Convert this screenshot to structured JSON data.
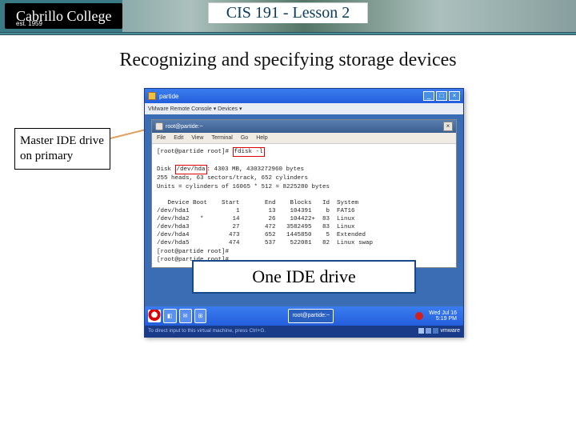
{
  "header": {
    "logo_text": "Cabrillo College",
    "logo_est": "est. 1959",
    "title": "CIS 191 - Lesson 2"
  },
  "slide": {
    "title": "Recognizing and specifying storage devices",
    "annotation": "Master  IDE drive on primary",
    "overlay": "One IDE drive"
  },
  "vm": {
    "title": "partide",
    "console_label": "VMware Remote Console ▾  Devices ▾",
    "win_min": "_",
    "win_max": "□",
    "win_close": "×",
    "status_left": "To direct input to this virtual machine, press Ctrl+G.",
    "brand": "vmware",
    "taskbar": {
      "term_label": "root@partide:~",
      "clock_day": "Wed Jul 16",
      "clock_time": "5:19 PM"
    }
  },
  "terminal": {
    "title": "root@partide:~",
    "menu": {
      "file": "File",
      "edit": "Edit",
      "view": "View",
      "terminal": "Terminal",
      "go": "Go",
      "help": "Help"
    },
    "prompt1": "[root@partide root]# ",
    "cmd": "fdisk -l",
    "blank": "",
    "line_disk_pre": "Disk ",
    "dev": "/dev/hda",
    "line_disk_post": ": 4303 MB, 4303272960 bytes",
    "line_geo": "255 heads, 63 sectors/track, 652 cylinders",
    "line_units": "Units = cylinders of 16065 * 512 = 8225280 bytes",
    "hdr": "   Device Boot    Start       End    Blocks   Id  System",
    "r1": "/dev/hda1             1        13    104391    b  FAT16",
    "r2": "/dev/hda2   *        14        26    104422+  83  Linux",
    "r3": "/dev/hda3            27       472   3582495   83  Linux",
    "r4": "/dev/hda4           473       652   1445850    5  Extended",
    "r5": "/dev/hda5           474       537    522081   82  Linux swap",
    "prompt2": "[root@partide root]# ",
    "prompt3": "[root@partide root]# "
  }
}
